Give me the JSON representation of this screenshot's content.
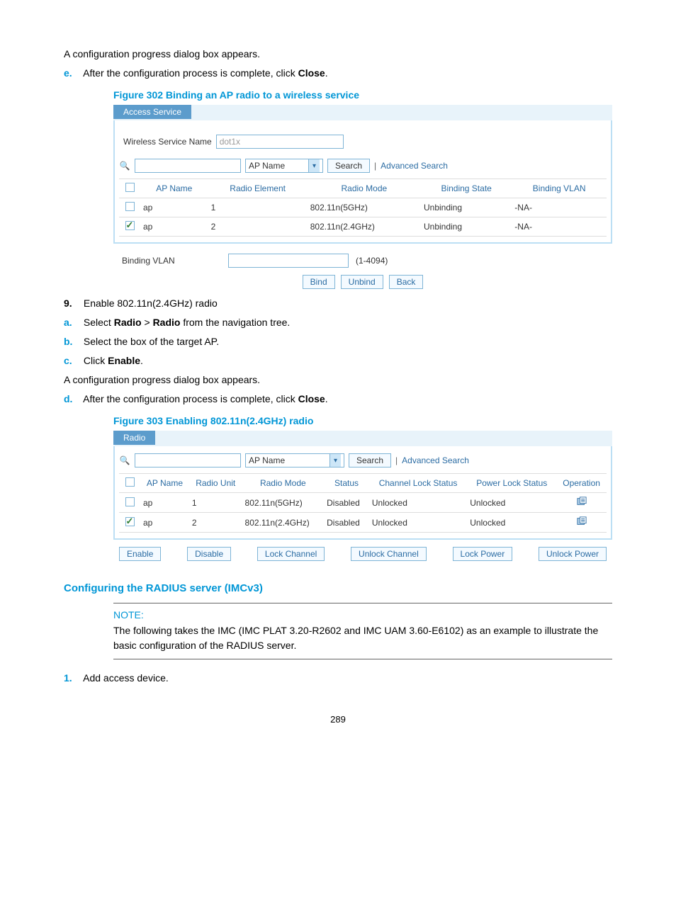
{
  "step_d_text": "A configuration progress dialog box appears.",
  "step_e": {
    "letter": "e.",
    "prefix": "After the configuration process is complete, click ",
    "bold": "Close",
    "suffix": "."
  },
  "figure302_caption": "Figure 302 Binding an AP radio to a wireless service",
  "figure302": {
    "tab": "Access Service",
    "wsn_label": "Wireless Service Name",
    "wsn_value": "dot1x",
    "search_placeholder": "",
    "select_value": "AP Name",
    "search_btn": "Search",
    "adv_search": "Advanced Search",
    "cols": [
      "AP Name",
      "Radio Element",
      "Radio Mode",
      "Binding State",
      "Binding VLAN"
    ],
    "rows": [
      {
        "checked": false,
        "ap": "ap",
        "elem": "1",
        "mode": "802.11n(5GHz)",
        "state": "Unbinding",
        "vlan": "-NA-"
      },
      {
        "checked": true,
        "ap": "ap",
        "elem": "2",
        "mode": "802.11n(2.4GHz)",
        "state": "Unbinding",
        "vlan": "-NA-"
      }
    ],
    "binding_vlan_label": "Binding VLAN",
    "binding_vlan_hint": "(1-4094)",
    "btns": [
      "Bind",
      "Unbind",
      "Back"
    ]
  },
  "step9": {
    "num": "9.",
    "text": "Enable 802.11n(2.4GHz) radio",
    "a": {
      "letter": "a.",
      "prefix": "Select ",
      "b1": "Radio",
      "mid": " > ",
      "b2": "Radio",
      "suffix": " from the navigation tree."
    },
    "b": {
      "letter": "b.",
      "text": "Select the box of the target AP."
    },
    "c": {
      "letter": "c.",
      "prefix": "Click ",
      "bold": "Enable",
      "suffix": "."
    },
    "c2": "A configuration progress dialog box appears.",
    "d": {
      "letter": "d.",
      "prefix": "After the configuration process is complete, click ",
      "bold": "Close",
      "suffix": "."
    }
  },
  "figure303_caption": "Figure 303 Enabling 802.11n(2.4GHz) radio",
  "figure303": {
    "tab": "Radio",
    "select_value": "AP Name",
    "search_btn": "Search",
    "adv_search": "Advanced Search",
    "cols": [
      "AP Name",
      "Radio Unit",
      "Radio Mode",
      "Status",
      "Channel Lock Status",
      "Power Lock Status",
      "Operation"
    ],
    "rows": [
      {
        "checked": false,
        "ap": "ap",
        "unit": "1",
        "mode": "802.11n(5GHz)",
        "status": "Disabled",
        "ch": "Unlocked",
        "pw": "Unlocked"
      },
      {
        "checked": true,
        "ap": "ap",
        "unit": "2",
        "mode": "802.11n(2.4GHz)",
        "status": "Disabled",
        "ch": "Unlocked",
        "pw": "Unlocked"
      }
    ],
    "btns": [
      "Enable",
      "Disable",
      "Lock Channel",
      "Unlock Channel",
      "Lock Power",
      "Unlock Power"
    ]
  },
  "section_heading": "Configuring the RADIUS server (IMCv3)",
  "note": {
    "label": "NOTE:",
    "text": "The following takes the IMC (IMC PLAT 3.20-R2602 and IMC UAM 3.60-E6102) as an example to illustrate the basic configuration of the RADIUS server."
  },
  "step1": {
    "num": "1.",
    "text": "Add access device."
  },
  "page_number": "289"
}
